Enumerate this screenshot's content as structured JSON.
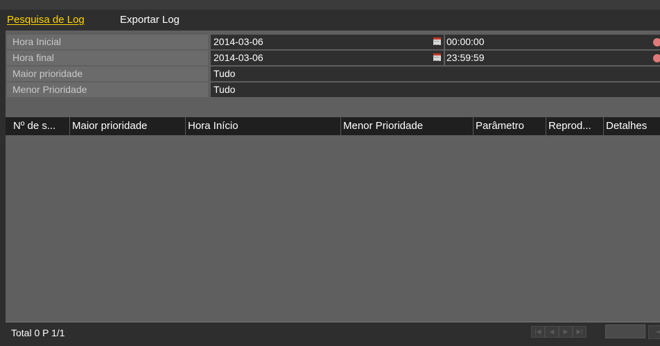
{
  "tabs": [
    {
      "label": "Pesquisa de Log",
      "active": true
    },
    {
      "label": "Exportar Log",
      "active": false
    }
  ],
  "filters": {
    "start": {
      "label": "Hora Inicial",
      "date": "2014-03-06",
      "time": "00:00:00"
    },
    "end": {
      "label": "Hora final",
      "date": "2014-03-06",
      "time": "23:59:59"
    },
    "major": {
      "label": "Maior prioridade",
      "value": "Tudo"
    },
    "minor": {
      "label": "Menor Prioridade",
      "value": "Tudo"
    }
  },
  "table": {
    "columns": [
      "Nº de s...",
      "Maior prioridade",
      "Hora Início",
      "Menor Prioridade",
      "Parâmetro",
      "Reprod...",
      "Detalhes"
    ],
    "rows": []
  },
  "footer": {
    "total": "Total 0 P 1/1",
    "page_input": "",
    "first_icon": "first-page-icon",
    "prev_icon": "prev-page-icon",
    "next_icon": "next-page-icon",
    "last_icon": "last-page-icon",
    "go_icon": "go-arrow-icon"
  },
  "colors": {
    "active_tab": "#ffd400",
    "panel": "#5f5f5f",
    "header": "#1f1f1f",
    "field_value": "#2f2f2f",
    "field_label": "#6b6b6b"
  }
}
